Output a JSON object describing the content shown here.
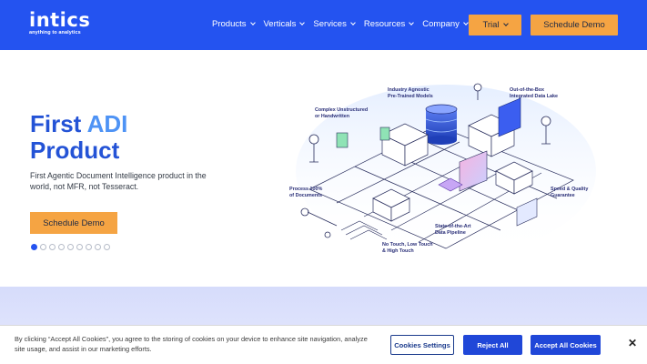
{
  "header": {
    "logo": {
      "word": "intics",
      "tagline": "anything to analytics"
    },
    "nav": [
      {
        "label": "Products"
      },
      {
        "label": "Verticals"
      },
      {
        "label": "Services"
      },
      {
        "label": "Resources"
      },
      {
        "label": "Company"
      }
    ],
    "trial_label": "Trial",
    "demo_label": "Schedule Demo"
  },
  "hero": {
    "title_part1": "First ",
    "title_accent": "ADI",
    "title_line2": "Product",
    "subtitle": "First Agentic Document Intelligence product in the world, not MFR, not Tesseract.",
    "cta_label": "Schedule Demo",
    "slides": {
      "count": 9,
      "active": 1
    }
  },
  "illustration": {
    "labels": {
      "l1a": "Industry Agnostic",
      "l1b": "Pre-Trained Models",
      "l2a": "Out-of-the-Box",
      "l2b": "Integrated Data Lake",
      "l3a": "Complex Unstructured",
      "l3b": "or Handwritten",
      "l4a": "Process 100%",
      "l4b": "of Documents",
      "l5a": "Speed & Quality",
      "l5b": "Guarantee",
      "l6a": "State-of-the-Art",
      "l6b": "Data Pipeline",
      "l7a": "No Touch, Low Touch",
      "l7b": "& High Touch"
    }
  },
  "cookie": {
    "text": "By clicking “Accept All Cookies”, you agree to the storing of cookies on your device to enhance site navigation, analyze site usage, and assist in our marketing efforts.",
    "settings_label": "Cookies Settings",
    "reject_label": "Reject All",
    "accept_label": "Accept All Cookies",
    "close_label": "✕"
  },
  "colors": {
    "brand": "#2453f0",
    "accent": "#f5a443",
    "title": "#2453d6",
    "title_accent": "#4e93f5"
  }
}
